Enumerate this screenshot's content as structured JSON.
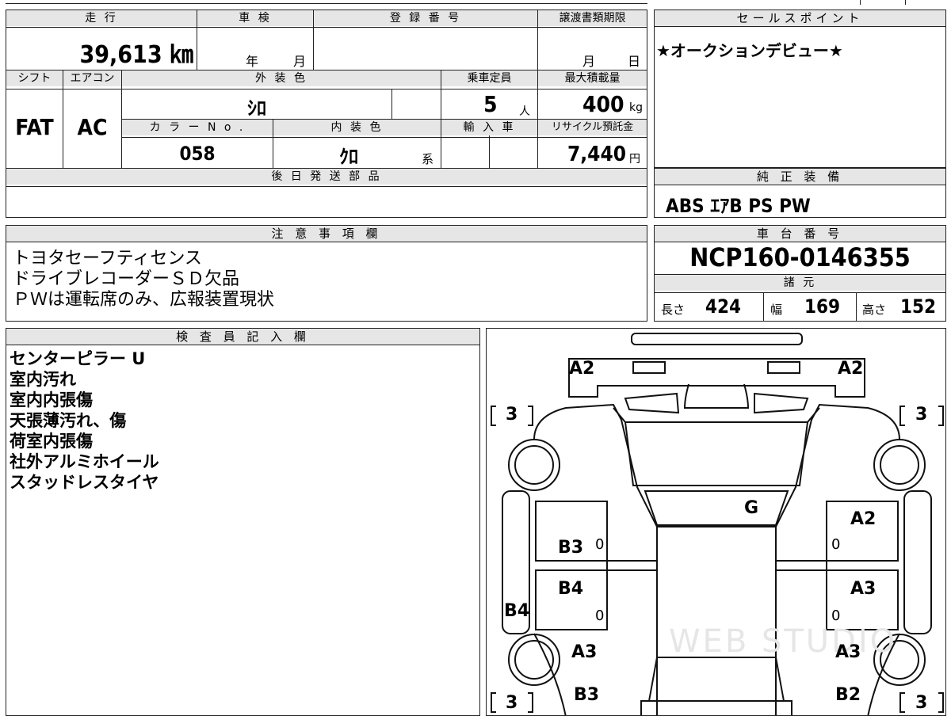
{
  "spec": {
    "mileage_header": "走 行",
    "mileage": "39,613 ㎞",
    "inspection_header": "車 検",
    "inspection_year": "年",
    "inspection_month": "月",
    "registration_header": "登 録 番 号",
    "transfer_deadline_header": "譲渡書類期限",
    "transfer_month": "月",
    "transfer_day": "日",
    "shift_header": "シフト",
    "shift": "FAT",
    "aircon_header": "エアコン",
    "aircon": "AC",
    "exterior_color_header": "外 装 色",
    "exterior_color": "ｼﾛ",
    "capacity_header": "乗車定員",
    "capacity": "5",
    "capacity_unit": "人",
    "max_load_header": "最大積載量",
    "max_load": "400",
    "max_load_unit": "kg",
    "color_no_header": "カ ラ ー N o .",
    "color_no": "058",
    "interior_color_header": "内 装 色",
    "interior_color": "ｸﾛ",
    "interior_suffix": "系",
    "import_header": "輸 入 車",
    "recycle_header": "リサイクル預託金",
    "recycle": "7,440",
    "recycle_unit": "円",
    "later_parts_header": "後 日 発 送 部 品"
  },
  "sales": {
    "header": "セールスポイント",
    "text": "★オークションデビュー★"
  },
  "equipment": {
    "header": "純 正 装 備",
    "text": "ABS ｴｱB PS PW"
  },
  "notes": {
    "header": "注 意 事 項 欄",
    "lines": [
      "トヨタセーフティセンス",
      "ドライブレコーダーＳＤ欠品",
      "ＰＷは運転席のみ、広報装置現状"
    ]
  },
  "chassis": {
    "header": "車 台 番 号",
    "number": "NCP160-0146355",
    "specs_header": "諸 元",
    "length_label": "長さ",
    "length": "424",
    "width_label": "幅",
    "width": "169",
    "height_label": "高さ",
    "height": "152"
  },
  "inspector": {
    "header": "検 査 員 記 入 欄",
    "lines": [
      "センターピラー U",
      "室内汚れ",
      "室内内張傷",
      "天張薄汚れ、傷",
      "荷室内張傷",
      "社外アルミホイール",
      "スタッドレスタイヤ"
    ]
  },
  "diagram": {
    "marks": [
      "A2",
      "A2",
      "G",
      "A2",
      "B3",
      "B4",
      "B4",
      "A3",
      "A3",
      "A3",
      "B3",
      "B2"
    ],
    "tire_marks": [
      "3",
      "3",
      "3",
      "3"
    ],
    "zeros": [
      "0",
      "0",
      "0",
      "0"
    ],
    "watermark": "WEB STUDIO"
  }
}
